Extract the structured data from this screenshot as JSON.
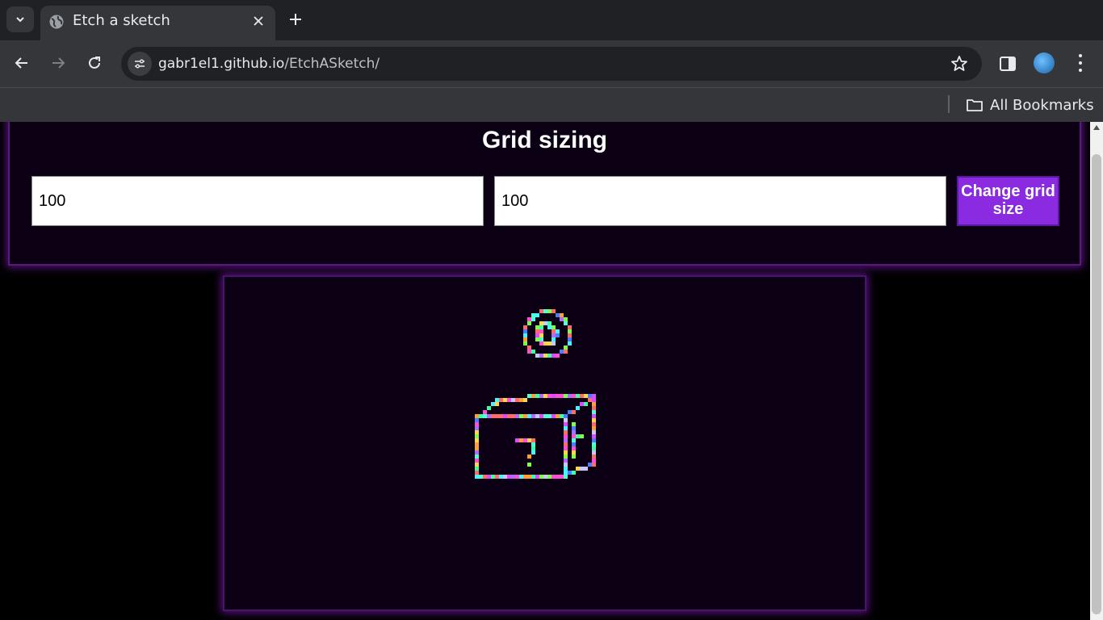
{
  "browser": {
    "tab_title": "Etch a sketch",
    "url_host": "gabr1el1.github.io",
    "url_path": "/EtchASketch/",
    "bookmarks_label": "All Bookmarks",
    "icons": [
      "tab-search-icon",
      "globe-icon",
      "close-icon",
      "plus-icon",
      "back-icon",
      "forward-icon",
      "reload-icon",
      "site-info-icon",
      "star-icon",
      "side-panel-icon",
      "avatar",
      "menu-icon",
      "folder-icon"
    ]
  },
  "page": {
    "sizing_title": "Grid sizing",
    "rows_value": "100",
    "cols_value": "100",
    "change_button_label": "Change grid size",
    "colors": {
      "panel_bg": "#0c0014",
      "panel_glow": "#5b1283",
      "button_bg": "#8a2be2"
    }
  }
}
